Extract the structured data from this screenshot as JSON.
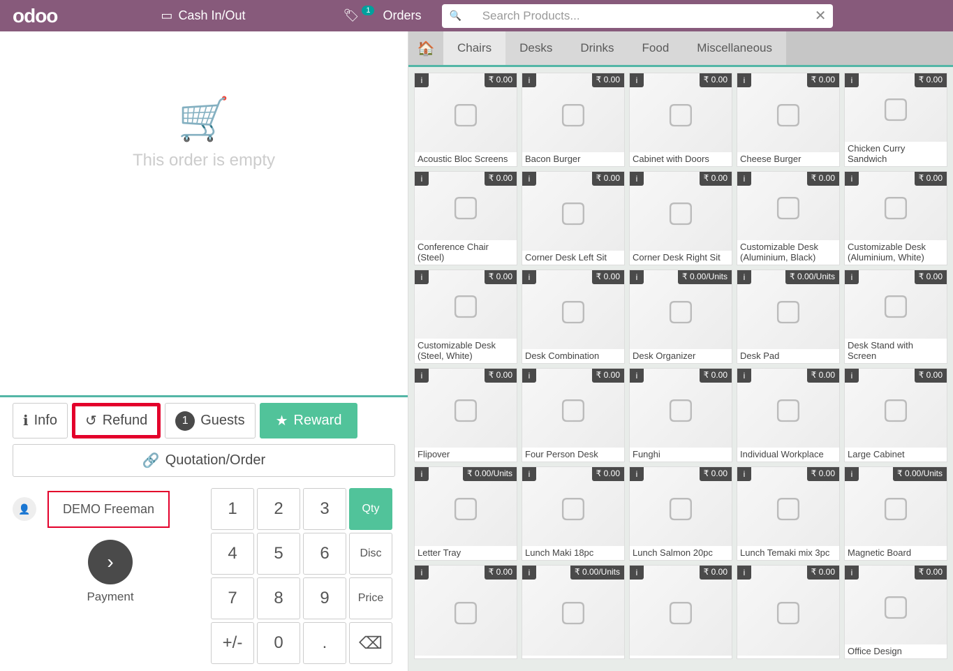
{
  "header": {
    "logo": "odoo",
    "cash_label": "Cash In/Out",
    "orders_label": "Orders",
    "orders_badge": "1",
    "search_placeholder": "Search Products..."
  },
  "order": {
    "empty_msg": "This order is empty"
  },
  "actions": {
    "info": "Info",
    "refund": "Refund",
    "guests": "Guests",
    "guests_count": "1",
    "reward": "Reward",
    "quotation": "Quotation/Order"
  },
  "customer": {
    "name": "DEMO Freeman"
  },
  "payment": {
    "label": "Payment"
  },
  "keypad": {
    "k1": "1",
    "k2": "2",
    "k3": "3",
    "qty": "Qty",
    "k4": "4",
    "k5": "5",
    "k6": "6",
    "disc": "Disc",
    "k7": "7",
    "k8": "8",
    "k9": "9",
    "price": "Price",
    "pm": "+/-",
    "k0": "0",
    "dot": ".",
    "back": "⌫"
  },
  "categories": {
    "chairs": "Chairs",
    "desks": "Desks",
    "drinks": "Drinks",
    "food": "Food",
    "misc": "Miscellaneous"
  },
  "products": [
    {
      "name": "Acoustic Bloc Screens",
      "price": "₹ 0.00"
    },
    {
      "name": "Bacon Burger",
      "price": "₹ 0.00"
    },
    {
      "name": "Cabinet with Doors",
      "price": "₹ 0.00"
    },
    {
      "name": "Cheese Burger",
      "price": "₹ 0.00"
    },
    {
      "name": "Chicken Curry Sandwich",
      "price": "₹ 0.00"
    },
    {
      "name": "Conference Chair (Steel)",
      "price": "₹ 0.00"
    },
    {
      "name": "Corner Desk Left Sit",
      "price": "₹ 0.00"
    },
    {
      "name": "Corner Desk Right Sit",
      "price": "₹ 0.00"
    },
    {
      "name": "Customizable Desk (Aluminium, Black)",
      "price": "₹ 0.00"
    },
    {
      "name": "Customizable Desk (Aluminium, White)",
      "price": "₹ 0.00"
    },
    {
      "name": "Customizable Desk (Steel, White)",
      "price": "₹ 0.00"
    },
    {
      "name": "Desk Combination",
      "price": "₹ 0.00"
    },
    {
      "name": "Desk Organizer",
      "price": "₹ 0.00/Units"
    },
    {
      "name": "Desk Pad",
      "price": "₹ 0.00/Units"
    },
    {
      "name": "Desk Stand with Screen",
      "price": "₹ 0.00"
    },
    {
      "name": "Flipover",
      "price": "₹ 0.00"
    },
    {
      "name": "Four Person Desk",
      "price": "₹ 0.00"
    },
    {
      "name": "Funghi",
      "price": "₹ 0.00"
    },
    {
      "name": "Individual Workplace",
      "price": "₹ 0.00"
    },
    {
      "name": "Large Cabinet",
      "price": "₹ 0.00"
    },
    {
      "name": "Letter Tray",
      "price": "₹ 0.00/Units"
    },
    {
      "name": "Lunch Maki 18pc",
      "price": "₹ 0.00"
    },
    {
      "name": "Lunch Salmon 20pc",
      "price": "₹ 0.00"
    },
    {
      "name": "Lunch Temaki mix 3pc",
      "price": "₹ 0.00"
    },
    {
      "name": "Magnetic Board",
      "price": "₹ 0.00/Units"
    },
    {
      "name": "",
      "price": "₹ 0.00"
    },
    {
      "name": "",
      "price": "₹ 0.00/Units"
    },
    {
      "name": "",
      "price": "₹ 0.00"
    },
    {
      "name": "",
      "price": "₹ 0.00"
    },
    {
      "name": "Office Design",
      "price": "₹ 0.00"
    }
  ]
}
